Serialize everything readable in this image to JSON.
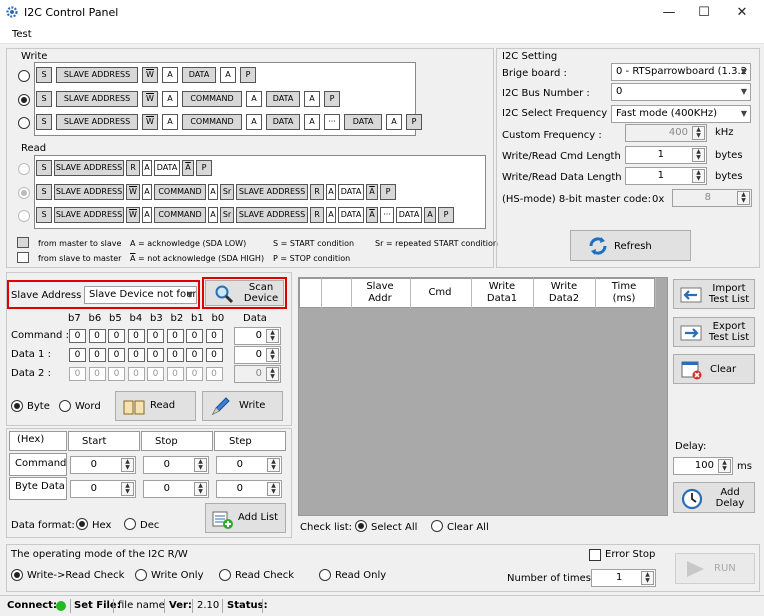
{
  "window": {
    "title": "I2C Control Panel",
    "minimize": "—",
    "maximize": "☐",
    "close": "✕"
  },
  "menu": {
    "test": "Test"
  },
  "write_group": {
    "title": "Write",
    "rows": [
      {
        "cells": [
          "S",
          "SLAVE ADDRESS",
          "W",
          "A",
          "DATA",
          "A",
          "P"
        ]
      },
      {
        "cells": [
          "S",
          "SLAVE ADDRESS",
          "W",
          "A",
          "COMMAND",
          "A",
          "DATA",
          "A",
          "P"
        ]
      },
      {
        "cells": [
          "S",
          "SLAVE ADDRESS",
          "W",
          "A",
          "COMMAND",
          "A",
          "DATA",
          "A",
          "···",
          "DATA",
          "A",
          "P"
        ]
      }
    ]
  },
  "read_group": {
    "title": "Read",
    "rows": [
      {
        "cells": [
          "S",
          "SLAVE ADDRESS",
          "R",
          "A",
          "DATA",
          "A",
          "P"
        ]
      },
      {
        "cells": [
          "S",
          "SLAVE ADDRESS",
          "W",
          "A",
          "COMMAND",
          "A",
          "Sr",
          "SLAVE ADDRESS",
          "R",
          "A",
          "DATA",
          "A",
          "P"
        ]
      },
      {
        "cells": [
          "S",
          "SLAVE ADDRESS",
          "W",
          "A",
          "COMMAND",
          "A",
          "Sr",
          "SLAVE ADDRESS",
          "R",
          "A",
          "DATA",
          "A",
          "···",
          "DATA",
          "A",
          "P"
        ]
      }
    ]
  },
  "legend": {
    "master_to_slave": "from master to slave",
    "slave_to_master": "from slave to master",
    "ack": "A = acknowledge (SDA LOW)",
    "nack_sym": "A",
    "nack": " = not acknowledge (SDA HIGH)",
    "start": "S = START condition",
    "stop": "P = STOP condition",
    "repeated": "Sr = repeated START condition"
  },
  "i2c_setting": {
    "title": "I2C Setting",
    "bridge_label": "Brige board :",
    "bridge_value": "0 - RTSparrowboard (1.3.2",
    "bus_label": "I2C Bus Number :",
    "bus_value": "0",
    "freq_label": "I2C Select Frequency :",
    "freq_value": "Fast  mode (400KHz)",
    "custom_label": "Custom Frequency :",
    "custom_value": "400",
    "custom_unit": "kHz",
    "cmd_len_label": "Write/Read Cmd Length :",
    "cmd_len_value": "1",
    "cmd_len_unit": "bytes",
    "data_len_label": "Write/Read Data Length :",
    "data_len_value": "1",
    "data_len_unit": "bytes",
    "hs_label": "(HS-mode) 8-bit master code:",
    "hs_prefix": "0x",
    "hs_value": "8",
    "refresh": "Refresh"
  },
  "slave": {
    "label": "Slave Address :",
    "value": "Slave Device not four",
    "scan": "Scan\nDevice"
  },
  "bits": {
    "headers": [
      "b7",
      "b6",
      "b5",
      "b4",
      "b3",
      "b2",
      "b1",
      "b0"
    ],
    "data_header": "Data",
    "rows": [
      {
        "label": "Command :",
        "bits": [
          "0",
          "0",
          "0",
          "0",
          "0",
          "0",
          "0",
          "0"
        ],
        "value": "0"
      },
      {
        "label": "Data 1 :",
        "bits": [
          "0",
          "0",
          "0",
          "0",
          "0",
          "0",
          "0",
          "0"
        ],
        "value": "0"
      },
      {
        "label": "Data 2 :",
        "bits": [
          "0",
          "0",
          "0",
          "0",
          "0",
          "0",
          "0",
          "0"
        ],
        "value": "0"
      }
    ]
  },
  "mode": {
    "byte": "Byte",
    "word": "Word",
    "read": "Read",
    "write": "Write"
  },
  "test_table": {
    "hex": "(Hex)",
    "start": "Start",
    "stop": "Stop",
    "step": "Step",
    "command": "Command",
    "byte_data": "Byte Data",
    "values": [
      "0",
      "0",
      "0",
      "0",
      "0",
      "0"
    ],
    "add_list": "Add List",
    "format_label": "Data format:",
    "hex_opt": "Hex",
    "dec_opt": "Dec"
  },
  "list": {
    "columns": [
      "Slave\nAddr",
      "Cmd",
      "Write\nData1",
      "Write\nData2",
      "Time\n(ms)"
    ],
    "check_label": "Check list:",
    "select_all": "Select All",
    "clear_all": "Clear All"
  },
  "side": {
    "import": "Import\nTest List",
    "export": "Export\nTest List",
    "clear": "Clear",
    "delay_label": "Delay:",
    "delay_value": "100",
    "delay_unit": "ms",
    "add_delay": "Add\nDelay"
  },
  "operating": {
    "title": "The operating mode of the I2C R/W",
    "options": [
      "Write->Read Check",
      "Write Only",
      "Read Check",
      "Read Only"
    ],
    "error_stop": "Error Stop",
    "times_label": "Number of times:",
    "times_value": "1",
    "run": "RUN"
  },
  "status": {
    "connect": "Connect:",
    "set_file": "Set File:",
    "file_name": "file name",
    "ver_label": "Ver:",
    "ver_value": "2.10",
    "status_label": "Status:"
  },
  "colors": {
    "highlight": "#e00000",
    "connect_led": "#22bb22",
    "list_bg": "#a9a9a9"
  }
}
